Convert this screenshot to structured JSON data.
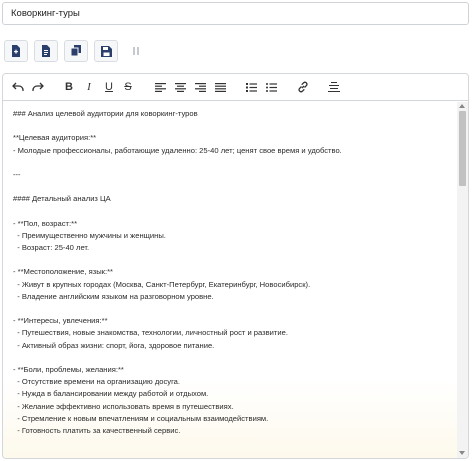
{
  "title_field": {
    "value": "Коворкинг-туры"
  },
  "action_buttons": [
    {
      "name": "new-doc-button",
      "icon": "document-plus-icon"
    },
    {
      "name": "open-doc-button",
      "icon": "document-icon"
    },
    {
      "name": "copy-button",
      "icon": "copy-icon"
    },
    {
      "name": "save-button",
      "icon": "floppy-disk-icon"
    },
    {
      "name": "pause-button",
      "icon": "pause-icon"
    }
  ],
  "toolbar": {
    "bold_label": "B",
    "italic_label": "I",
    "underline_label": "U",
    "strike_label": "S"
  },
  "content_lines": [
    "### Анализ целевой аудитории для коворкинг-туров",
    "",
    "**Целевая аудитория:**",
    "- Молодые профессионалы, работающие удаленно: 25-40 лет; ценят свое время и удобство.",
    "",
    "---",
    "",
    "#### Детальный анализ ЦА",
    "",
    "- **Пол, возраст:**",
    "  - Преимущественно мужчины и женщины.",
    "  - Возраст: 25-40 лет.",
    "",
    "- **Местоположение, язык:**",
    "  - Живут в крупных городах (Москва, Санкт-Петербург, Екатеринбург, Новосибирск).",
    "  - Владение английским языком на разговорном уровне.",
    "",
    "- **Интересы, увлечения:**",
    "  - Путешествия, новые знакомства, технологии, личностный рост и развитие.",
    "  - Активный образ жизни: спорт, йога, здоровое питание.",
    "",
    "- **Боли, проблемы, желания:**",
    "  - Отсутствие времени на организацию досуга.",
    "  - Нужда в балансировании между работой и отдыхом.",
    "  - Желание эффективно использовать время в путешествиях.",
    "  - Стремление к новым впечатлениям и социальным взаимодействиям.",
    "  - Готовность платить за качественный сервис."
  ]
}
